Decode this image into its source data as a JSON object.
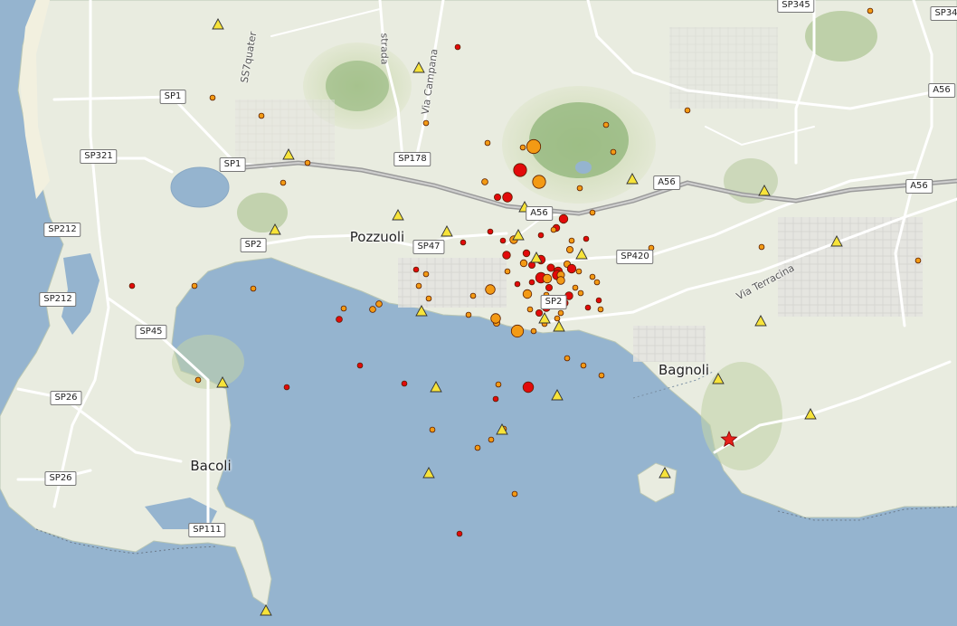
{
  "places": [
    {
      "name": "Pozzuoli"
    },
    {
      "name": "Bagnoli"
    },
    {
      "name": "Bacoli"
    }
  ],
  "road_shields": [
    "SP345",
    "SP34",
    "SP1",
    "SP1",
    "SP321",
    "SP178",
    "A56",
    "A56",
    "A56",
    "A56",
    "SP212",
    "SP212",
    "SP2",
    "SP47",
    "SP420",
    "SP45",
    "SP26",
    "SP26",
    "SP111",
    "SP2"
  ],
  "street_labels": [
    "SS7quater",
    "strada",
    "Via Campana",
    "Via Terracina"
  ],
  "colors": {
    "sea": "#95b4cf",
    "land": "#e9ece0",
    "hill": "#b6c99a",
    "crater": "#8fb478",
    "road": "#ffffff",
    "motorway": "#9b9b9b",
    "quake_red": "#e20a0a",
    "quake_orange": "#f39a14",
    "station_yellow": "#f7e33a",
    "star_red": "#e8201a"
  },
  "icons": {
    "earthquake": "circle-marker-icon",
    "station": "triangle-marker-icon",
    "epicenter": "star-marker-icon"
  },
  "quakes": [
    {
      "t": "o",
      "m": 3.2
    },
    {
      "t": "o",
      "m": 3.0
    },
    {
      "t": "r",
      "m": 2.4
    },
    {
      "t": "r",
      "m": 2.2
    },
    {
      "t": "r",
      "m": 2.0
    },
    {
      "t": "r",
      "m": 2.0
    },
    {
      "t": "o",
      "m": 1.6
    },
    {
      "t": "r",
      "m": 1.8
    },
    {
      "t": "o",
      "m": 1.6
    },
    {
      "t": "r",
      "m": 1.5
    },
    {
      "t": "r",
      "m": 1.8
    },
    {
      "t": "r",
      "m": 1.6
    },
    {
      "t": "o",
      "m": 1.5
    },
    {
      "t": "r",
      "m": 1.7
    },
    {
      "t": "r",
      "m": 2.0
    },
    {
      "t": "o",
      "m": 1.6
    },
    {
      "t": "r",
      "m": 1.5
    },
    {
      "t": "r",
      "m": 2.2
    },
    {
      "t": "r",
      "m": 1.8
    },
    {
      "t": "o",
      "m": 1.5
    },
    {
      "t": "r",
      "m": 1.5
    },
    {
      "t": "o",
      "m": 1.7
    },
    {
      "t": "r",
      "m": 2.4
    },
    {
      "t": "r",
      "m": 2.0
    },
    {
      "t": "o",
      "m": 2.2
    },
    {
      "t": "o",
      "m": 2.8
    },
    {
      "t": "o",
      "m": 2.2
    },
    {
      "t": "o",
      "m": 2.0
    },
    {
      "t": "r",
      "m": 1.8
    },
    {
      "t": "r",
      "m": 1.5
    },
    {
      "t": "r",
      "m": 1.7
    },
    {
      "t": "o",
      "m": 2.0
    },
    {
      "t": "o",
      "m": 1.8
    },
    {
      "t": "o",
      "m": 1.5
    },
    {
      "t": "r",
      "m": 1.6
    },
    {
      "t": "r",
      "m": 2.0
    },
    {
      "t": "o",
      "m": 1.8
    },
    {
      "t": "r",
      "m": 3.0
    },
    {
      "t": "o",
      "m": 1.2
    },
    {
      "t": "o",
      "m": 1.2
    },
    {
      "t": "o",
      "m": 1.2
    },
    {
      "t": "o",
      "m": 1.2
    },
    {
      "t": "o",
      "m": 1.2
    },
    {
      "t": "r",
      "m": 1.2
    },
    {
      "t": "o",
      "m": 1.2
    },
    {
      "t": "o",
      "m": 1.4
    },
    {
      "t": "r",
      "m": 1.4
    },
    {
      "t": "r",
      "m": 1.2
    },
    {
      "t": "r",
      "m": 1.2
    },
    {
      "t": "r",
      "m": 1.2
    },
    {
      "t": "o",
      "m": 1.2
    },
    {
      "t": "o",
      "m": 1.2
    },
    {
      "t": "r",
      "m": 1.2
    },
    {
      "t": "o",
      "m": 1.2
    },
    {
      "t": "o",
      "m": 1.4
    },
    {
      "t": "o",
      "m": 1.2
    },
    {
      "t": "o",
      "m": 1.2
    },
    {
      "t": "o",
      "m": 1.2
    },
    {
      "t": "o",
      "m": 1.2
    },
    {
      "t": "r",
      "m": 1.2
    },
    {
      "t": "r",
      "m": 1.2
    },
    {
      "t": "o",
      "m": 1.2
    },
    {
      "t": "o",
      "m": 1.4
    },
    {
      "t": "o",
      "m": 1.2
    },
    {
      "t": "o",
      "m": 1.2
    },
    {
      "t": "o",
      "m": 1.2
    },
    {
      "t": "o",
      "m": 1.2
    },
    {
      "t": "o",
      "m": 1.2
    },
    {
      "t": "o",
      "m": 1.2
    },
    {
      "t": "o",
      "m": 1.2
    },
    {
      "t": "o",
      "m": 1.2
    },
    {
      "t": "o",
      "m": 1.2
    },
    {
      "t": "o",
      "m": 1.2
    },
    {
      "t": "o",
      "m": 1.2
    },
    {
      "t": "o",
      "m": 1.2
    },
    {
      "t": "o",
      "m": 1.2
    },
    {
      "t": "o",
      "m": 1.2
    },
    {
      "t": "r",
      "m": 1.2
    },
    {
      "t": "o",
      "m": 1.2
    },
    {
      "t": "o",
      "m": 1.2
    },
    {
      "t": "o",
      "m": 1.2
    },
    {
      "t": "o",
      "m": 1.2
    },
    {
      "t": "o",
      "m": 1.2
    },
    {
      "t": "o",
      "m": 1.2
    },
    {
      "t": "o",
      "m": 1.2
    },
    {
      "t": "r",
      "m": 1.2
    },
    {
      "t": "r",
      "m": 1.2
    },
    {
      "t": "r",
      "m": 1.2
    },
    {
      "t": "r",
      "m": 1.2
    },
    {
      "t": "o",
      "m": 1.2
    },
    {
      "t": "o",
      "m": 1.2
    },
    {
      "t": "r",
      "m": 1.2
    },
    {
      "t": "o",
      "m": 1.2
    },
    {
      "t": "r",
      "m": 1.2
    },
    {
      "t": "r",
      "m": 1.2
    },
    {
      "t": "o",
      "m": 1.2
    },
    {
      "t": "r",
      "m": 1.2
    },
    {
      "t": "o",
      "m": 1.2
    },
    {
      "t": "o",
      "m": 1.2
    },
    {
      "t": "o",
      "m": 1.2
    },
    {
      "t": "o",
      "m": 1.2
    },
    {
      "t": "o",
      "m": 1.2
    },
    {
      "t": "o",
      "m": 1.2
    },
    {
      "t": "o",
      "m": 1.2
    },
    {
      "t": "r",
      "m": 1.2
    },
    {
      "t": "o",
      "m": 1.2
    },
    {
      "t": "o",
      "m": 1.2
    },
    {
      "t": "o",
      "m": 1.2
    },
    {
      "t": "o",
      "m": 1.2
    },
    {
      "t": "r",
      "m": 1.2
    },
    {
      "t": "o",
      "m": 1.2
    }
  ],
  "stations_count": 26,
  "epicenter_count": 1
}
